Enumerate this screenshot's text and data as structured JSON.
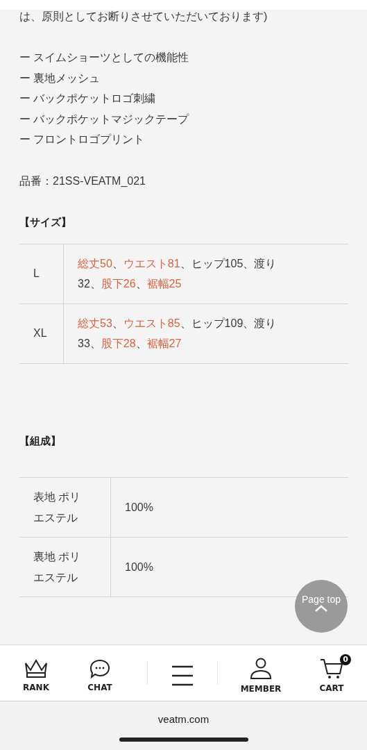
{
  "intro_text": "は、原則としてお断りさせていただいております)",
  "features": [
    "ー スイムショーツとしての機能性",
    "ー 裏地メッシュ",
    "ー バックポケットロゴ刺繍",
    "ー バックポケットマジックテープ",
    "ー フロントロゴプリント"
  ],
  "product_code": "品番：21SS-VEATM_021",
  "size_section": {
    "heading": "【サイズ】",
    "rows": [
      {
        "size": "L",
        "measurements": [
          {
            "text": "総丈50",
            "highlight": true
          },
          {
            "text": "、",
            "highlight": false
          },
          {
            "text": "ウエスト81",
            "highlight": true
          },
          {
            "text": "、ヒップ105、渡り32、",
            "highlight": false
          },
          {
            "text": "股下26",
            "highlight": true
          },
          {
            "text": "、",
            "highlight": false
          },
          {
            "text": "裾幅25",
            "highlight": true
          }
        ]
      },
      {
        "size": "XL",
        "measurements": [
          {
            "text": "総丈53",
            "highlight": true
          },
          {
            "text": "、",
            "highlight": false
          },
          {
            "text": "ウエスト85",
            "highlight": true
          },
          {
            "text": "、ヒップ109、渡り33、",
            "highlight": false
          },
          {
            "text": "股下28",
            "highlight": true
          },
          {
            "text": "、",
            "highlight": false
          },
          {
            "text": "裾幅27",
            "highlight": true
          }
        ]
      }
    ]
  },
  "composition_section": {
    "heading": "【組成】",
    "rows": [
      {
        "material": "表地 ポリエステル",
        "percent": "100%"
      },
      {
        "material": "裏地 ポリエステル",
        "percent": "100%"
      }
    ]
  },
  "page_top_button": {
    "label": "Page top"
  },
  "bottom_nav": [
    {
      "kind": "rank",
      "label": "RANK"
    },
    {
      "kind": "chat",
      "label": "CHAT"
    },
    {
      "kind": "menu"
    },
    {
      "kind": "member",
      "label": "MEMBER"
    },
    {
      "kind": "cart",
      "label": "CART",
      "badge": "0"
    }
  ],
  "browser": {
    "url": "veatm.com"
  }
}
